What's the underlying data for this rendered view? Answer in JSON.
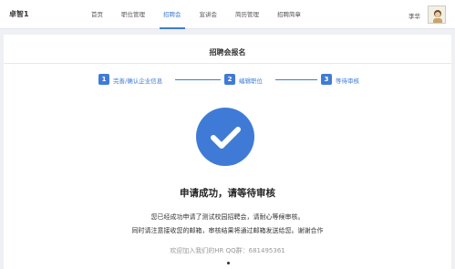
{
  "header": {
    "brand": "卓智1",
    "nav": [
      {
        "label": "首页",
        "active": false
      },
      {
        "label": "职位管理",
        "active": false
      },
      {
        "label": "招聘会",
        "active": true
      },
      {
        "label": "宣讲会",
        "active": false
      },
      {
        "label": "简历管理",
        "active": false
      },
      {
        "label": "招聘简章",
        "active": false
      }
    ],
    "user_name": "李华"
  },
  "page": {
    "title": "招聘会报名",
    "steps": [
      {
        "num": "1",
        "label": "完善/确认企业信息"
      },
      {
        "num": "2",
        "label": "编辑职位"
      },
      {
        "num": "3",
        "label": "等待审核"
      }
    ],
    "headline": "申请成功，请等待审核",
    "desc_line1": "您已经成功申请了测试校园招聘会，请耐心等候审核。",
    "desc_line2": "同时请注意接收您的邮箱，审核结果将通过邮箱发送给您。谢谢合作",
    "qq_text": "欢迎加入我们的HR QQ群：681495361"
  },
  "colors": {
    "accent": "#3f7bd6",
    "background": "#eef0f3"
  }
}
